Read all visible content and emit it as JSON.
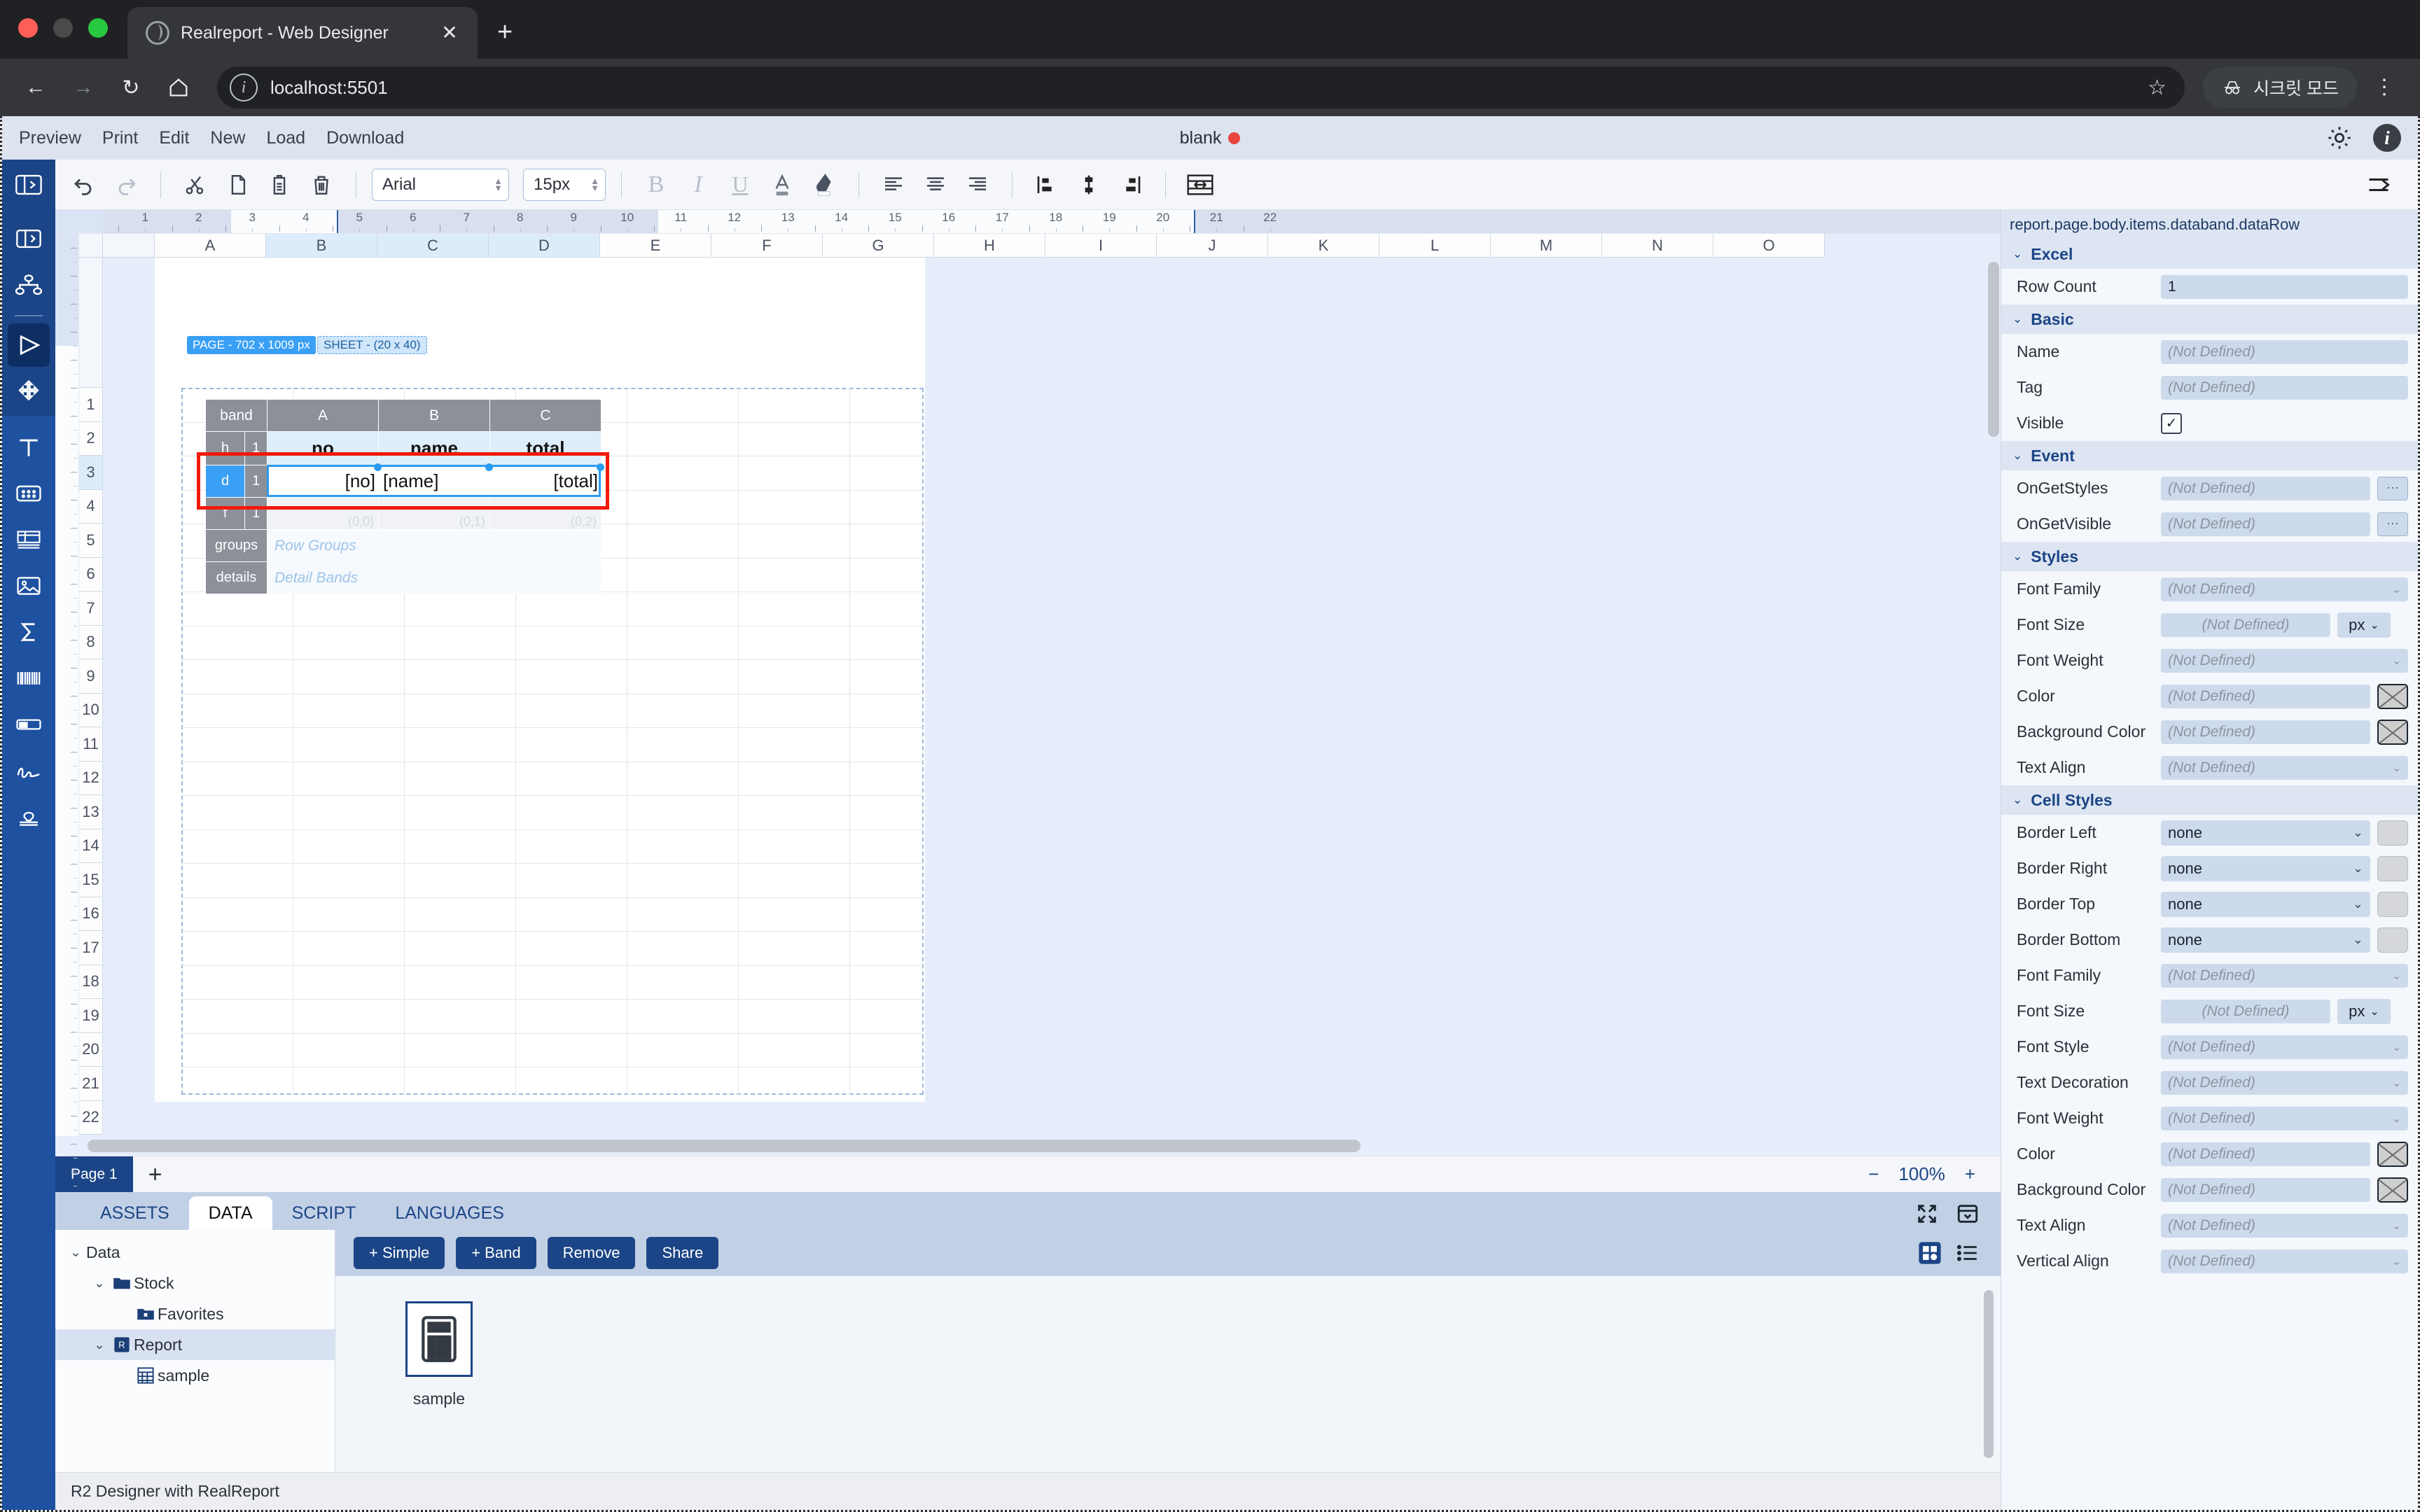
{
  "browser": {
    "tab_title": "Realreport - Web Designer",
    "tab_close": "✕",
    "new_tab": "+",
    "back": "←",
    "forward": "→",
    "reload": "↻",
    "home": "⌂",
    "url": "localhost:5501",
    "star": "☆",
    "incognito_label": "시크릿 모드",
    "kebab": "⋮"
  },
  "menubar": {
    "items": [
      "Preview",
      "Print",
      "Edit",
      "New",
      "Load",
      "Download"
    ],
    "doc_title": "blank",
    "gear_icon": "gear-icon",
    "info_icon": "info-icon"
  },
  "toolbar": {
    "panel_toggle_icon": "panel-toggle-icon",
    "undo_icon": "undo-icon",
    "redo_icon": "redo-icon",
    "cut_icon": "cut-icon",
    "copy_icon": "copy-icon",
    "paste_icon": "paste-icon",
    "delete_icon": "trash-icon",
    "font_family": "Arial",
    "font_size": "15px",
    "bold": "B",
    "italic": "I",
    "underline": "U",
    "font_color": "A",
    "fill_color": "fill-icon",
    "align_left_icon": "align-left-icon",
    "align_center_icon": "align-center-icon",
    "align_right_icon": "align-right-icon",
    "valign_top_icon": "valign-top-icon",
    "valign_middle_icon": "valign-middle-icon",
    "valign_bottom_icon": "valign-bottom-icon",
    "merge_icon": "merge-cells-icon",
    "overflow_icon": "toolbar-overflow-icon"
  },
  "rail": {
    "items": [
      {
        "name": "panel-expand-icon"
      },
      {
        "name": "hierarchy-icon"
      },
      {
        "name": "select-tool-icon",
        "active": true
      },
      {
        "name": "move-tool-icon"
      },
      {
        "name": "text-tool-icon"
      },
      {
        "name": "shape-tool-icon"
      },
      {
        "name": "table-tool-icon"
      },
      {
        "name": "image-tool-icon"
      },
      {
        "name": "sum-tool-icon"
      },
      {
        "name": "barcode-tool-icon"
      },
      {
        "name": "progress-tool-icon"
      },
      {
        "name": "signature-tool-icon"
      },
      {
        "name": "stamp-tool-icon"
      }
    ]
  },
  "canvas": {
    "page_badge": "PAGE - 702 x 1009 px",
    "sheet_badge": "SHEET - (20 x 40)",
    "columns": [
      "A",
      "B",
      "C",
      "D",
      "E",
      "F",
      "G",
      "H",
      "I",
      "J",
      "K",
      "L",
      "M",
      "N",
      "O"
    ],
    "selected_columns": [
      "B",
      "C",
      "D"
    ],
    "rows": [
      "1",
      "2",
      "3",
      "4",
      "5",
      "6",
      "7",
      "8",
      "9",
      "10",
      "11",
      "12",
      "13",
      "14",
      "15",
      "16",
      "17",
      "18",
      "19",
      "20",
      "21",
      "22"
    ],
    "selected_row": "3",
    "ruler_h_labels": [
      "1",
      "2",
      "3",
      "4",
      "5",
      "6",
      "7",
      "8",
      "9",
      "10",
      "11",
      "12",
      "13",
      "14",
      "15",
      "16",
      "17",
      "18",
      "19",
      "20",
      "21",
      "22"
    ],
    "band_header": "band",
    "band_columns": [
      "A",
      "B",
      "C"
    ],
    "bands": [
      {
        "code": "h",
        "count": "1"
      },
      {
        "code": "d",
        "count": "1",
        "active": true
      },
      {
        "code": "f",
        "count": "1"
      }
    ],
    "header_cells": [
      "no",
      "name",
      "total"
    ],
    "data_cells": [
      "[no]",
      "[name]",
      "[total]"
    ],
    "footer_coords": [
      "(0,0)",
      "(0,1)",
      "(0,2)"
    ],
    "groups_label": "groups",
    "groups_placeholder": "Row Groups",
    "details_label": "details",
    "details_placeholder": "Detail Bands"
  },
  "pagebar": {
    "page_tab": "Page 1",
    "add": "+",
    "zoom_out": "−",
    "zoom_level": "100%",
    "zoom_in": "+"
  },
  "dock": {
    "tabs": [
      {
        "label": "ASSETS",
        "active": false
      },
      {
        "label": "DATA",
        "active": true
      },
      {
        "label": "SCRIPT",
        "active": false
      },
      {
        "label": "LANGUAGES",
        "active": false
      }
    ],
    "expand_icon": "expand-icon",
    "collapse_icon": "collapse-panel-icon",
    "tree": [
      {
        "label": "Data",
        "indent": 0,
        "caret": "⌄",
        "icon": "none",
        "selected": false
      },
      {
        "label": "Stock",
        "indent": 1,
        "caret": "⌄",
        "icon": "folder-icon",
        "selected": false
      },
      {
        "label": "Favorites",
        "indent": 2,
        "caret": "",
        "icon": "favorites-folder-icon",
        "selected": false
      },
      {
        "label": "Report",
        "indent": 1,
        "caret": "⌄",
        "icon": "report-icon",
        "selected": true
      },
      {
        "label": "sample",
        "indent": 2,
        "caret": "",
        "icon": "dataset-icon",
        "selected": false
      }
    ],
    "actions": [
      "+ Simple",
      "+ Band",
      "Remove",
      "Share"
    ],
    "view_grid_icon": "grid-view-icon",
    "view_list_icon": "list-view-icon",
    "items": [
      {
        "label": "sample",
        "icon": "dataset-icon"
      }
    ]
  },
  "statusbar": {
    "text": "R2 Designer with RealReport"
  },
  "props": {
    "path": "report.page.body.items.databand.dataRow",
    "not_defined": "(Not Defined)",
    "groups": [
      {
        "title": "Excel",
        "rows": [
          {
            "label": "Row Count",
            "type": "value",
            "value": "1"
          }
        ]
      },
      {
        "title": "Basic",
        "rows": [
          {
            "label": "Name",
            "type": "placeholder",
            "value": "(Not Defined)"
          },
          {
            "label": "Tag",
            "type": "placeholder",
            "value": "(Not Defined)"
          },
          {
            "label": "Visible",
            "type": "checkbox",
            "value": "✓"
          }
        ]
      },
      {
        "title": "Event",
        "rows": [
          {
            "label": "OnGetStyles",
            "type": "placeholder-dots",
            "value": "(Not Defined)",
            "dots": "⋯"
          },
          {
            "label": "OnGetVisible",
            "type": "placeholder-dots",
            "value": "(Not Defined)",
            "dots": "⋯"
          }
        ]
      },
      {
        "title": "Styles",
        "rows": [
          {
            "label": "Font Family",
            "type": "placeholder-caret",
            "value": "(Not Defined)"
          },
          {
            "label": "Font Size",
            "type": "placeholder-unit",
            "value": "(Not Defined)",
            "unit": "px"
          },
          {
            "label": "Font Weight",
            "type": "placeholder-caret",
            "value": "(Not Defined)"
          },
          {
            "label": "Color",
            "type": "placeholder-swatchx",
            "value": "(Not Defined)"
          },
          {
            "label": "Background Color",
            "type": "placeholder-swatchx",
            "value": "(Not Defined)"
          },
          {
            "label": "Text Align",
            "type": "placeholder-caret",
            "value": "(Not Defined)"
          }
        ]
      },
      {
        "title": "Cell Styles",
        "rows": [
          {
            "label": "Border Left",
            "type": "select-swatch",
            "value": "none"
          },
          {
            "label": "Border Right",
            "type": "select-swatch",
            "value": "none"
          },
          {
            "label": "Border Top",
            "type": "select-swatch",
            "value": "none"
          },
          {
            "label": "Border Bottom",
            "type": "select-swatch",
            "value": "none"
          },
          {
            "label": "Font Family",
            "type": "placeholder-caret",
            "value": "(Not Defined)"
          },
          {
            "label": "Font Size",
            "type": "placeholder-unit",
            "value": "(Not Defined)",
            "unit": "px"
          },
          {
            "label": "Font Style",
            "type": "placeholder-caret",
            "value": "(Not Defined)"
          },
          {
            "label": "Text Decoration",
            "type": "placeholder-caret",
            "value": "(Not Defined)"
          },
          {
            "label": "Font Weight",
            "type": "placeholder-caret",
            "value": "(Not Defined)"
          },
          {
            "label": "Color",
            "type": "placeholder-swatchx",
            "value": "(Not Defined)"
          },
          {
            "label": "Background Color",
            "type": "placeholder-swatchx",
            "value": "(Not Defined)"
          },
          {
            "label": "Text Align",
            "type": "placeholder-caret",
            "value": "(Not Defined)"
          },
          {
            "label": "Vertical Align",
            "type": "placeholder-caret",
            "value": "(Not Defined)"
          }
        ]
      }
    ]
  },
  "colors": {
    "brand": "#1b4586",
    "accent": "#2b9cf0",
    "highlight": "#f21a0b",
    "panel": "#f4f7fc",
    "field": "#ccdaec"
  }
}
